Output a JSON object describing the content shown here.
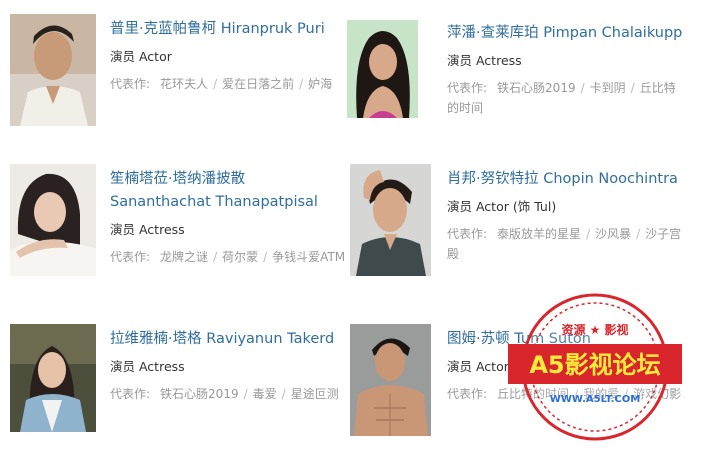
{
  "cast": [
    {
      "name": "普里·克蓝帕鲁柯 Hiranpruk Puri",
      "role": "演员 Actor",
      "works_label": "代表作:",
      "works": [
        "花环夫人",
        "爱在日落之前",
        "妒海"
      ]
    },
    {
      "name": "萍潘·查莱库珀 Pimpan Chalaikupp",
      "role": "演员 Actress",
      "works_label": "代表作:",
      "works": [
        "铁石心肠2019",
        "卡到阴",
        "丘比特的时间"
      ]
    },
    {
      "name": "笙楠塔莅·塔纳潘披散 Sananthachat Thanapatpisal",
      "role": "演员 Actress",
      "works_label": "代表作:",
      "works": [
        "龙牌之谜",
        "荷尔蒙",
        "争钱斗爱ATM"
      ]
    },
    {
      "name": "肖邦·努钦特拉 Chopin Noochintra",
      "role": "演员 Actor (饰 Tul)",
      "works_label": "代表作:",
      "works": [
        "泰版放羊的星星",
        "沙风暴",
        "沙子宫殿"
      ]
    },
    {
      "name": "拉维雅楠·塔格 Raviyanun Takerd",
      "role": "演员 Actress",
      "works_label": "代表作:",
      "works": [
        "铁石心肠2019",
        "毒爱",
        "星途叵测"
      ]
    },
    {
      "name": "图姆·苏顿 Tum Suton",
      "role": "演员 Actor",
      "works_label": "代表作:",
      "works": [
        "丘比特的时间",
        "我的爱",
        "游戏幻影"
      ]
    }
  ],
  "watermark": {
    "top_text": "资源 ★ 影视",
    "main_text": "A5影视论坛",
    "url": "WWW.A5LT.COM",
    "color": "#d9262c"
  }
}
